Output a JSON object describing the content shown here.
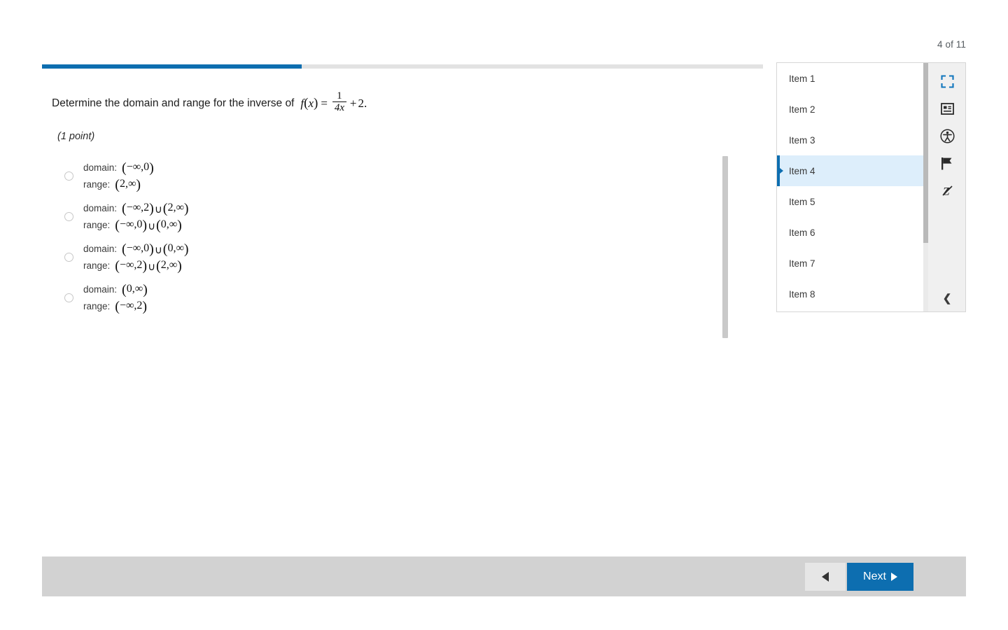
{
  "header": {
    "page_counter": "4 of 11"
  },
  "progress": {
    "percent": 36
  },
  "question": {
    "prompt": "Determine the domain and range for the inverse of",
    "formula": {
      "fn": "f",
      "open_paren": "(",
      "var": "x",
      "close_paren": ")",
      "equals": "=",
      "numerator": "1",
      "denominator": "4x",
      "plus": "+",
      "constant": "2",
      "period": "."
    },
    "points": "(1 point)"
  },
  "options": [
    {
      "domain_label": "domain:",
      "domain_value": "(−∞,0)",
      "range_label": "range:",
      "range_value": "(2,∞)"
    },
    {
      "domain_label": "domain:",
      "domain_value": "(−∞,2)∪(2,∞)",
      "range_label": "range:",
      "range_value": "(−∞,0)∪(0,∞)"
    },
    {
      "domain_label": "domain:",
      "domain_value": "(−∞,0)∪(0,∞)",
      "range_label": "range:",
      "range_value": "(−∞,2)∪(2,∞)"
    },
    {
      "domain_label": "domain:",
      "domain_value": "(0,∞)",
      "range_label": "range:",
      "range_value": "(−∞,2)"
    }
  ],
  "item_panel": {
    "items": [
      {
        "label": "Item 1",
        "active": false
      },
      {
        "label": "Item 2",
        "active": false
      },
      {
        "label": "Item 3",
        "active": false
      },
      {
        "label": "Item 4",
        "active": true
      },
      {
        "label": "Item 5",
        "active": false
      },
      {
        "label": "Item 6",
        "active": false
      },
      {
        "label": "Item 7",
        "active": false
      },
      {
        "label": "Item 8",
        "active": false
      }
    ]
  },
  "toolbar": {
    "icons": [
      "fullscreen-icon",
      "reference-card-icon",
      "accessibility-icon",
      "flag-icon",
      "pause-assist-icon"
    ],
    "collapse_glyph": "❮"
  },
  "footer": {
    "prev_label": "",
    "next_label": "Next"
  },
  "colors": {
    "accent_blue": "#0d6eb0",
    "active_item_bg": "#ddeefb",
    "footer_bg": "#d2d2d2",
    "progress_track": "#e2e2e2"
  }
}
